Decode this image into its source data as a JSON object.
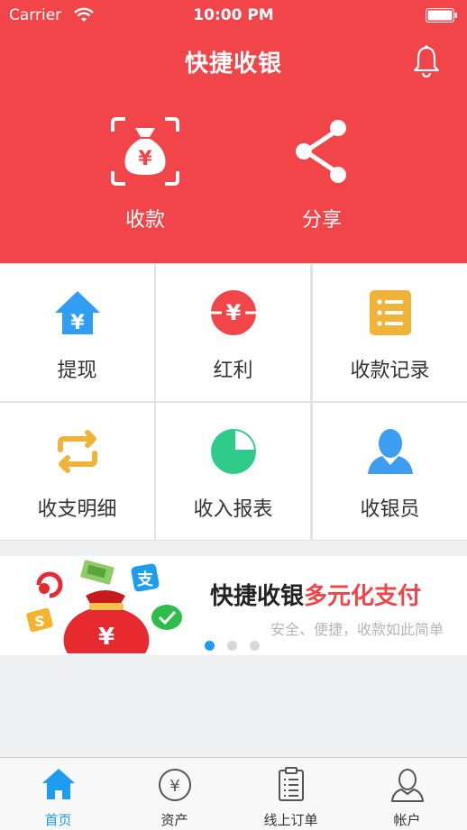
{
  "status_bar": {
    "carrier": "Carrier",
    "time": "10:00 PM"
  },
  "header": {
    "title": "快捷收银"
  },
  "hero": [
    {
      "label": "收款",
      "icon": "money-bag-scan-icon"
    },
    {
      "label": "分享",
      "icon": "share-icon"
    }
  ],
  "grid": [
    {
      "label": "提现",
      "icon": "house-yen-icon"
    },
    {
      "label": "红利",
      "icon": "red-yen-circle-icon"
    },
    {
      "label": "收款记录",
      "icon": "list-icon"
    },
    {
      "label": "收支明细",
      "icon": "swap-arrows-icon"
    },
    {
      "label": "收入报表",
      "icon": "pie-chart-icon"
    },
    {
      "label": "收银员",
      "icon": "cashier-person-icon"
    }
  ],
  "banner": {
    "title_part1": "快捷收银",
    "title_part2": "多元化支付",
    "subtitle": "安全、便捷，收款如此简单",
    "yen": "¥",
    "pages": 3,
    "active_page": 1
  },
  "tabbar": [
    {
      "label": "首页",
      "icon": "home-icon",
      "active": true
    },
    {
      "label": "资产",
      "icon": "yen-circle-icon",
      "active": false
    },
    {
      "label": "线上订单",
      "icon": "order-list-icon",
      "active": false
    },
    {
      "label": "帐户",
      "icon": "account-icon",
      "active": false
    }
  ],
  "colors": {
    "brand_red": "#f1454a",
    "accent_blue": "#1e9cf0",
    "orange": "#efb33a",
    "green": "#2ecb8a"
  }
}
